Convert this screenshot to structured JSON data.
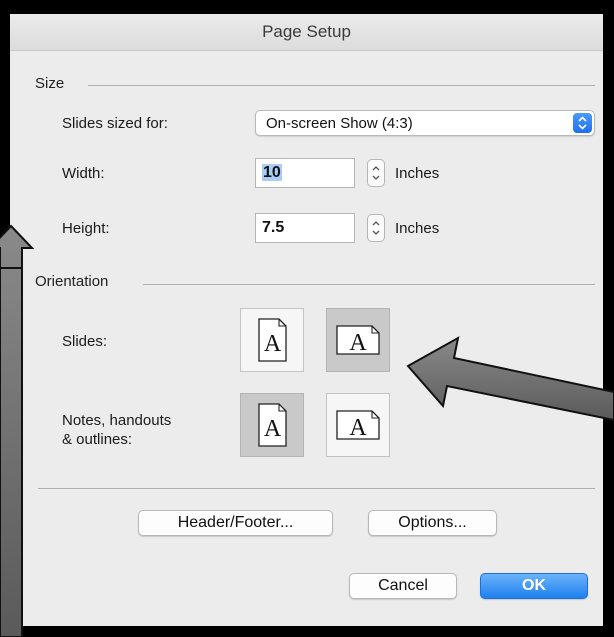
{
  "dialog": {
    "title": "Page Setup",
    "size_section": "Size",
    "orientation_section": "Orientation",
    "slides_sized_for_label": "Slides sized for:",
    "slides_sized_for_value": "On-screen Show (4:3)",
    "width_label": "Width:",
    "width_value": "10",
    "height_label": "Height:",
    "height_value": "7.5",
    "unit": "Inches",
    "slides_label": "Slides:",
    "notes_label_line1": "Notes, handouts",
    "notes_label_line2": "& outlines:",
    "orientation_glyph": "A",
    "slides_orientation": "landscape",
    "notes_orientation": "portrait",
    "header_footer_label": "Header/Footer...",
    "options_label": "Options...",
    "cancel_label": "Cancel",
    "ok_label": "OK"
  },
  "colors": {
    "accent_blue": "#1e80ef",
    "dialog_bg": "#ececec",
    "frame": "#000000",
    "annotation_arrow": "#6e6e6e"
  }
}
